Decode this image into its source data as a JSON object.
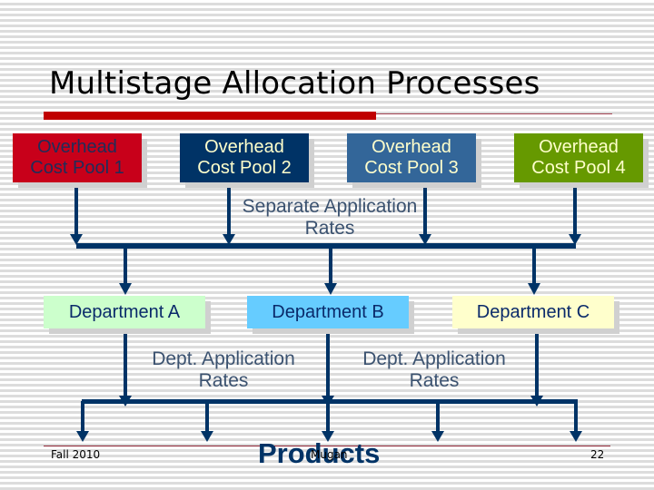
{
  "slide": {
    "title": "Multistage Allocation Processes",
    "accent_color": "#c00000",
    "arrow_color": "#003366"
  },
  "cost_pools": [
    {
      "line1": "Overhead",
      "line2": "Cost Pool 1",
      "color": "#c8001a"
    },
    {
      "line1": "Overhead",
      "line2": "Cost Pool 2",
      "color": "#003366"
    },
    {
      "line1": "Overhead",
      "line2": "Cost Pool 3",
      "color": "#336699"
    },
    {
      "line1": "Overhead",
      "line2": "Cost Pool 4",
      "color": "#669900"
    }
  ],
  "labels": {
    "separate_rates": {
      "line1": "Separate Application",
      "line2": "Rates"
    },
    "dept_rates_1": {
      "line1": "Dept. Application",
      "line2": "Rates"
    },
    "dept_rates_2": {
      "line1": "Dept. Application",
      "line2": "Rates"
    }
  },
  "departments": [
    {
      "label": "Department A",
      "color": "#ccffcc"
    },
    {
      "label": "Department B",
      "color": "#66ccff"
    },
    {
      "label": "Department C",
      "color": "#ffffcc"
    }
  ],
  "products": {
    "label": "Products"
  },
  "footer": {
    "left": "Fall 2010",
    "center": "Mugan",
    "page_number": "22"
  }
}
